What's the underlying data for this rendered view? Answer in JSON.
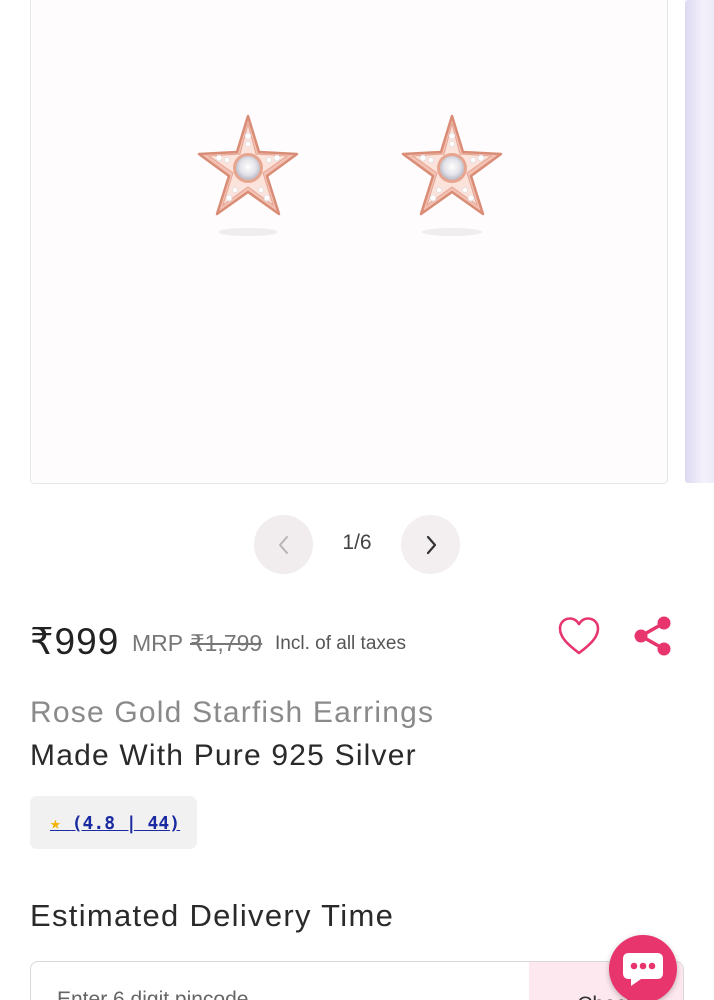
{
  "gallery": {
    "image_name": "rose-gold-starfish-earrings-image",
    "counter": "1/6"
  },
  "price": {
    "current": "₹999",
    "mrp_label": "MRP",
    "mrp_value": "₹1,799",
    "tax_note": "Incl. of all taxes"
  },
  "product": {
    "title_line1": "Rose Gold Starfish Earrings",
    "title_line2": "Made With Pure 925 Silver"
  },
  "rating": {
    "star": "★",
    "text": "(4.8 | 44)"
  },
  "delivery": {
    "heading": "Estimated Delivery Time",
    "pincode_placeholder": "Enter 6 digit pincode",
    "check_label": "Check"
  },
  "icons": {
    "prev": "chevron-left-icon",
    "next": "chevron-right-icon",
    "wishlist": "heart-icon",
    "share": "share-icon",
    "chat": "chat-icon"
  },
  "colors": {
    "accent": "#e8356d",
    "rose_gold": "#e7a48f",
    "link": "#1a2aa0",
    "star": "#f2b400"
  }
}
